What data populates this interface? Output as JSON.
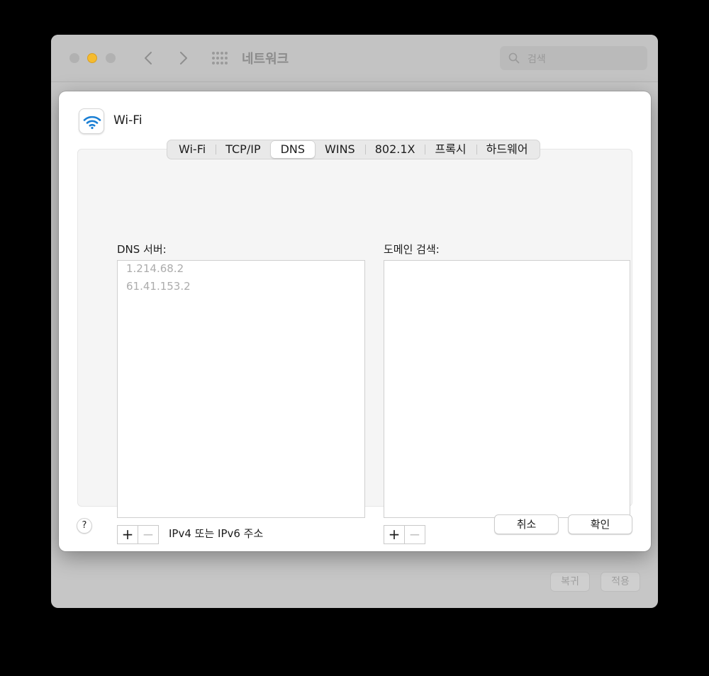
{
  "window": {
    "title": "네트워크",
    "search_placeholder": "검색",
    "revert_label": "복귀",
    "apply_label": "적용"
  },
  "sheet": {
    "title": "Wi-Fi",
    "tabs": [
      {
        "label": "Wi-Fi",
        "active": false
      },
      {
        "label": "TCP/IP",
        "active": false
      },
      {
        "label": "DNS",
        "active": true
      },
      {
        "label": "WINS",
        "active": false
      },
      {
        "label": "802.1X",
        "active": false
      },
      {
        "label": "프록시",
        "active": false
      },
      {
        "label": "하드웨어",
        "active": false
      }
    ],
    "dns": {
      "label": "DNS 서버:",
      "servers": [
        "1.214.68.2",
        "61.41.153.2"
      ],
      "hint": "IPv4 또는 IPv6 주소"
    },
    "search_domains": {
      "label": "도메인 검색:",
      "entries": []
    },
    "plus_symbol": "+",
    "minus_symbol": "−",
    "help_symbol": "?",
    "cancel_label": "취소",
    "ok_label": "확인"
  },
  "colors": {
    "accent": "#1a7fd4",
    "minimize": "#f5bb2f"
  },
  "icons": [
    "chevron-left-icon",
    "chevron-right-icon",
    "grid-icon",
    "search-icon",
    "wifi-icon"
  ]
}
